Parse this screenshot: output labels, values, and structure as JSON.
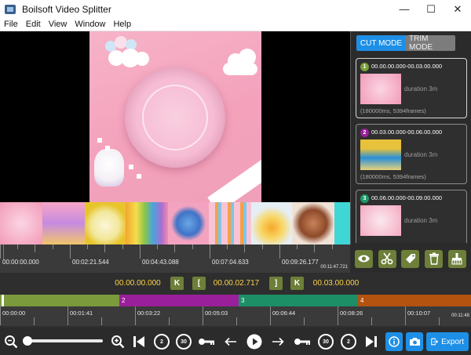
{
  "window": {
    "title": "Boilsoft Video Splitter",
    "minimize": "—",
    "maximize": "☐",
    "close": "✕"
  },
  "menu": [
    "File",
    "Edit",
    "View",
    "Window",
    "Help"
  ],
  "modes": {
    "cut": "CUT MODE",
    "trim": "TRIM MODE"
  },
  "segments": [
    {
      "num": "1",
      "range": "00.00.00.000-00.03.00.000",
      "duration": "duration 3m",
      "info": "(180000ms, 5394frames)",
      "color": "#7aa03a",
      "thumb": "#f6b7cc"
    },
    {
      "num": "2",
      "range": "00.03.00.000-00.06.00.000",
      "duration": "duration 3m",
      "info": "(180000ms, 5394frames)",
      "color": "#9b1f9b",
      "thumb": "#e8c23b"
    },
    {
      "num": "3",
      "range": "00.06.00.000-00.09.00.000",
      "duration": "duration 3m",
      "info": "",
      "color": "#1f9a6a",
      "thumb": "#f4a9c0"
    }
  ],
  "ruler_top": {
    "labels": [
      "00:00:00.000",
      "00:02:21.544",
      "00:04:43.088",
      "00:07:04.633",
      "00:09:26.177"
    ],
    "end": "00:11:47.721"
  },
  "position": {
    "start": "00.00.00.000",
    "current": "00.00.02.717",
    "end": "00.03.00.000",
    "btn_prev": "K",
    "btn_start": "[",
    "btn_end": "]",
    "btn_next": "K"
  },
  "segbar": [
    {
      "label": "",
      "color": "#7a9a3c"
    },
    {
      "label": "2",
      "color": "#9a1f9a"
    },
    {
      "label": "3",
      "color": "#1d8f66"
    },
    {
      "label": "4",
      "color": "#b3530f"
    }
  ],
  "ruler_bottom": {
    "labels": [
      "00:00:00",
      "00:01:41",
      "00:03:22",
      "00:05:03",
      "00:06:44",
      "00:08:26",
      "00:10:07"
    ],
    "end": "00:11:48"
  },
  "toolbar": {
    "skip_back_2": "2",
    "skip_back_30": "30",
    "skip_fwd_30": "30",
    "skip_fwd_2": "2",
    "export": "Export"
  },
  "colors": {
    "accent_blue": "#1e8fe6",
    "action_green": "#6d7f38",
    "time_yellow": "#ffd24a"
  }
}
